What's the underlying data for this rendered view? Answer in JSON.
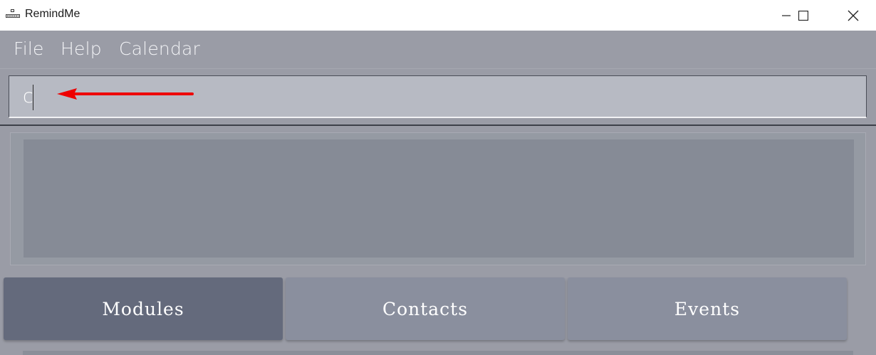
{
  "window": {
    "title": "RemindMe",
    "icon": "remindme-app-icon",
    "controls": [
      "minimize-icon",
      "maximize-icon",
      "close-icon"
    ]
  },
  "menu": {
    "items": [
      {
        "label": "File"
      },
      {
        "label": "Help"
      },
      {
        "label": "Calendar"
      }
    ]
  },
  "command": {
    "value": "c",
    "annotation": "red-arrow-pointing-left"
  },
  "tabs": [
    {
      "label": "Modules",
      "selected": true
    },
    {
      "label": "Contacts",
      "selected": false
    },
    {
      "label": "Events",
      "selected": false
    }
  ],
  "colors": {
    "tab_active": "#646a7c",
    "tab_inactive": "#8a8f9e",
    "annotation_arrow": "#ee0000"
  }
}
